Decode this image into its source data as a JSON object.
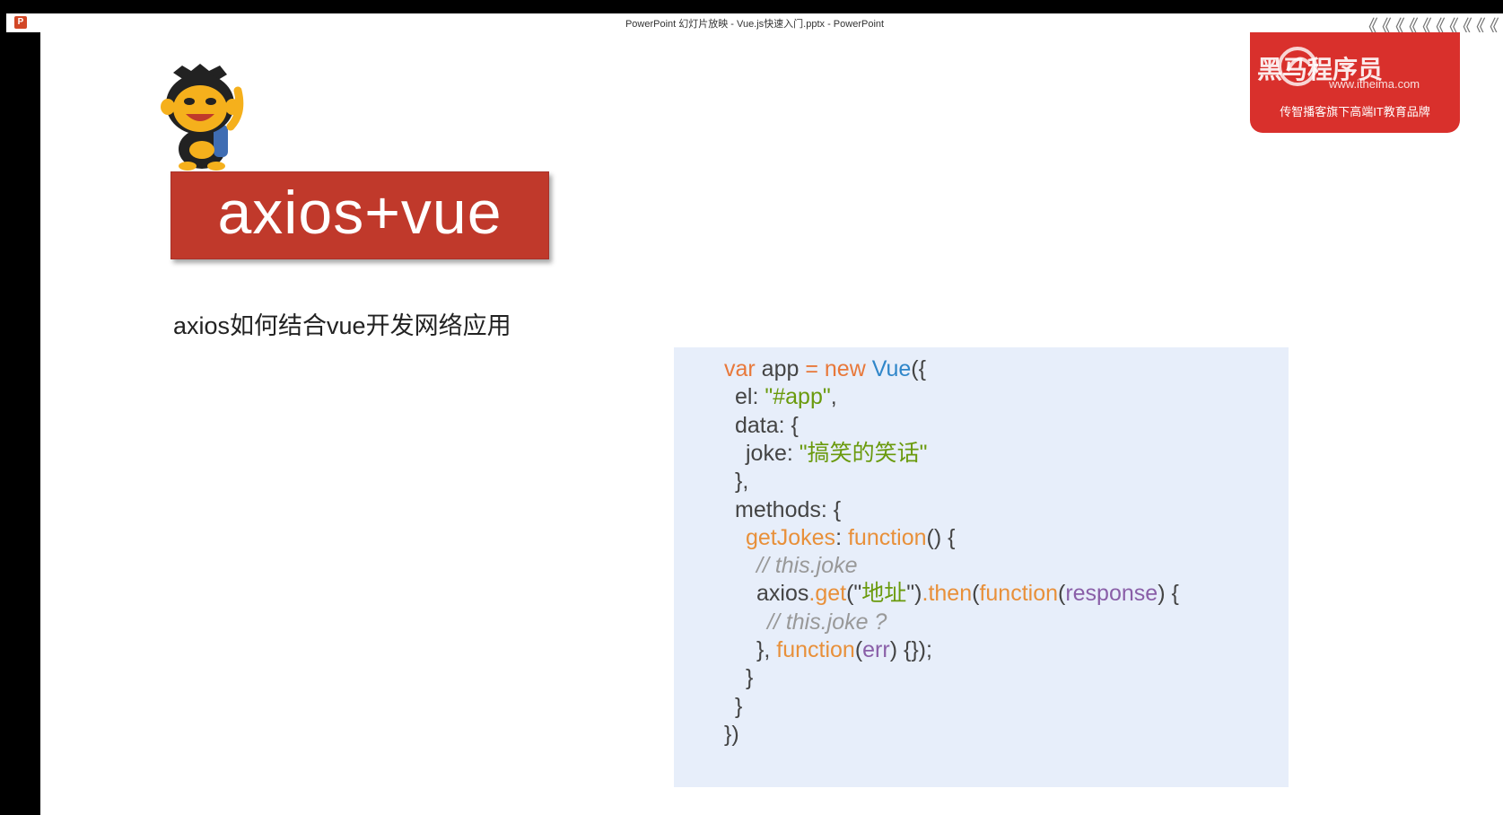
{
  "window": {
    "title": "PowerPoint 幻灯片放映  -  Vue.js快速入门.pptx - PowerPoint",
    "app_icon": "P",
    "chevrons": "《《《《《《《《《《"
  },
  "brand": {
    "name": "黑马程序员",
    "url": "www.itheima.com",
    "tagline": "传智播客旗下高端IT教育品牌"
  },
  "slide": {
    "title": "axios+vue",
    "subtitle": "axios如何结合vue开发网络应用",
    "code_lines": [
      {
        "indent": 0,
        "tokens": [
          [
            "kw",
            "var"
          ],
          [
            "p",
            " app "
          ],
          [
            "kw",
            "= new "
          ],
          [
            "cls",
            "Vue"
          ],
          [
            "p",
            "({"
          ]
        ]
      },
      {
        "indent": 1,
        "tokens": [
          [
            "p",
            "el: "
          ],
          [
            "str",
            "\"#app\""
          ],
          [
            "p",
            ","
          ]
        ]
      },
      {
        "indent": 1,
        "tokens": [
          [
            "p",
            "data: {"
          ]
        ]
      },
      {
        "indent": 2,
        "tokens": [
          [
            "p",
            "joke: "
          ],
          [
            "str",
            "\"搞笑的笑话\""
          ]
        ]
      },
      {
        "indent": 1,
        "tokens": [
          [
            "p",
            "},"
          ]
        ]
      },
      {
        "indent": 1,
        "tokens": [
          [
            "p",
            "methods: {"
          ]
        ]
      },
      {
        "indent": 2,
        "tokens": [
          [
            "fn",
            "getJokes"
          ],
          [
            "p",
            ": "
          ],
          [
            "fn",
            "function"
          ],
          [
            "p",
            "() {"
          ]
        ]
      },
      {
        "indent": 3,
        "tokens": [
          [
            "cm",
            "// this.joke"
          ]
        ]
      },
      {
        "indent": 3,
        "tokens": [
          [
            "p",
            "axios"
          ],
          [
            "fn",
            ".get"
          ],
          [
            "p",
            "(\""
          ],
          [
            "str",
            "地址"
          ],
          [
            "p",
            "\")"
          ],
          [
            "fn",
            ".then"
          ],
          [
            "p",
            "("
          ],
          [
            "fn",
            "function"
          ],
          [
            "p",
            "("
          ],
          [
            "arg",
            "response"
          ],
          [
            "p",
            ") {"
          ]
        ]
      },
      {
        "indent": 4,
        "tokens": [
          [
            "cm",
            "// this.joke ?"
          ]
        ]
      },
      {
        "indent": 3,
        "tokens": [
          [
            "p",
            "}, "
          ],
          [
            "fn",
            "function"
          ],
          [
            "p",
            "("
          ],
          [
            "arg",
            "err"
          ],
          [
            "p",
            ") {});"
          ]
        ]
      },
      {
        "indent": 2,
        "tokens": [
          [
            "p",
            "}"
          ]
        ]
      },
      {
        "indent": 1,
        "tokens": [
          [
            "p",
            "}"
          ]
        ]
      },
      {
        "indent": 0,
        "tokens": [
          [
            "p",
            "})"
          ]
        ]
      }
    ]
  },
  "colors": {
    "title_box": "#c0392b",
    "code_bg": "#e7eefa",
    "keyword": "#e8783a",
    "class": "#2f86c9",
    "string": "#6a9a0c",
    "argument": "#8a5fa8",
    "comment": "#999999",
    "brand": "#d9302c"
  }
}
